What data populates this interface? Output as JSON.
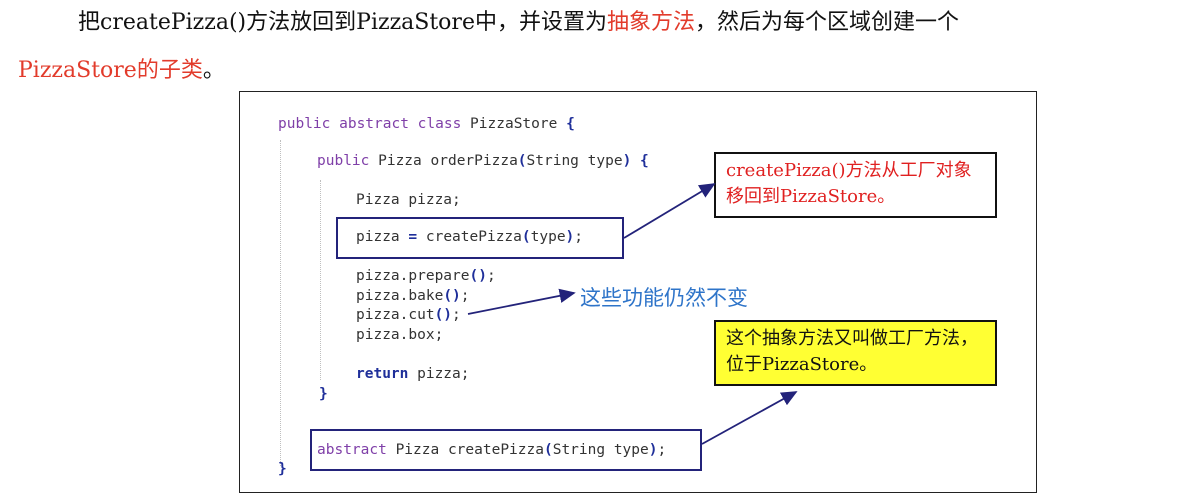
{
  "paragraph": {
    "line1_a": "把createPizza()方法放回到PizzaStore中，并设置为",
    "line1_red": "抽象方法",
    "line1_b": "，然后为每个区域创建一个",
    "line2_red": "PizzaStore的子类",
    "line2_b": "。"
  },
  "code": {
    "l1_kw": "public abstract class",
    "l1_rest": " PizzaStore ",
    "l1_brace": "{",
    "l2_kw": "public",
    "l2_rest": " Pizza orderPizza",
    "l2_paren_open": "(",
    "l2_args": "String type",
    "l2_paren_close": ")",
    "l2_brace": " {",
    "l3": "Pizza pizza;",
    "l4_a": "pizza ",
    "l4_eq": "=",
    "l4_b": " createPizza",
    "l4_po": "(",
    "l4_arg": "type",
    "l4_pc": ")",
    "l4_semi": ";",
    "l5_a": "pizza.prepare",
    "l5_p": "()",
    "l5_s": ";",
    "l6_a": "pizza.bake",
    "l6_p": "()",
    "l6_s": ";",
    "l7_a": "pizza.cut",
    "l7_p": "()",
    "l7_s": ";",
    "l8": "pizza.box;",
    "l9_kw": "return",
    "l9_rest": " pizza;",
    "l10": "}",
    "l11_kw": "abstract",
    "l11_rest": " Pizza createPizza",
    "l11_po": "(",
    "l11_args": "String type",
    "l11_pc": ")",
    "l11_s": ";",
    "l12": "}"
  },
  "annotations": {
    "note_top": "createPizza()方法从工厂对象移回到PizzaStore。",
    "side_label": "这些功能仍然不变",
    "note_bottom": "这个抽象方法又叫做工厂方法，位于PizzaStore。"
  },
  "colors": {
    "red": "#e23b2b",
    "keyword": "#7f3fa8",
    "box_border": "#23237a",
    "label_blue": "#2e74c9",
    "note_yellow": "#ffff33"
  }
}
